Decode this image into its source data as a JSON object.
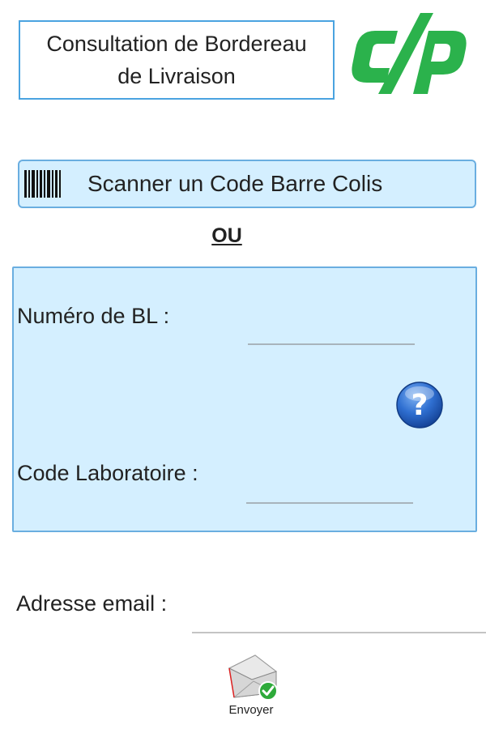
{
  "header": {
    "title_line1": "Consultation de Bordereau",
    "title_line2": "de Livraison",
    "logo_icon": "csp-logo",
    "logo_color": "#2bb24c"
  },
  "scan": {
    "label": "Scanner un Code Barre Colis",
    "icon": "barcode-icon"
  },
  "separator": {
    "text": "OU"
  },
  "form": {
    "bl_label": "Numéro de BL :",
    "bl_value": "",
    "lab_label": "Code Laboratoire :",
    "lab_value": "",
    "help_icon": "help-question-icon",
    "panel_color": "#d4efff"
  },
  "email": {
    "label": "Adresse email :",
    "value": ""
  },
  "send": {
    "label": "Envoyer",
    "icon": "envelope-check-icon"
  }
}
